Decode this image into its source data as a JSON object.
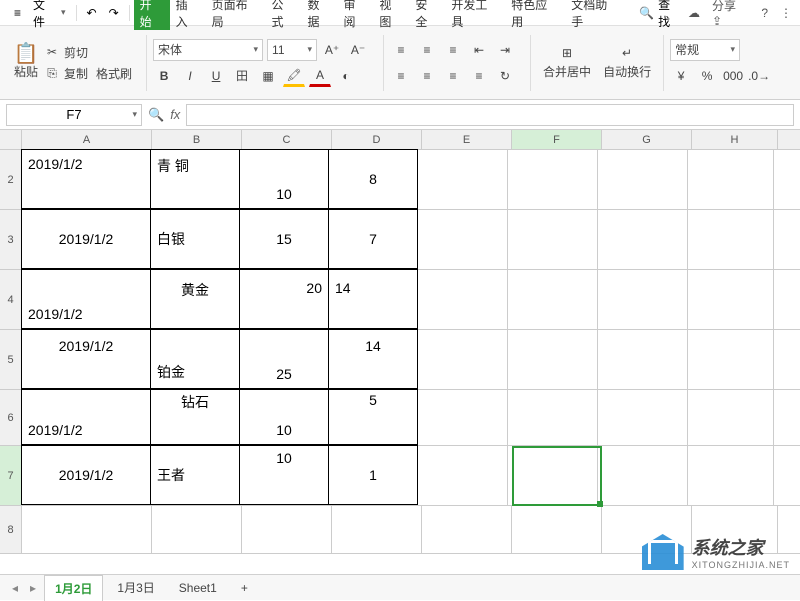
{
  "menu": {
    "file": "文件",
    "tabs": [
      "开始",
      "插入",
      "页面布局",
      "公式",
      "数据",
      "审阅",
      "视图",
      "安全",
      "开发工具",
      "特色应用",
      "文档助手"
    ],
    "search": "查找",
    "share": "分享"
  },
  "ribbon": {
    "paste": "粘贴",
    "cut": "剪切",
    "copy": "复制",
    "format_painter": "格式刷",
    "font_name": "宋体",
    "font_size": "11",
    "merge": "合并居中",
    "wrap": "自动换行",
    "general": "常规"
  },
  "namebox": "F7",
  "fx": "fx",
  "columns": [
    "A",
    "B",
    "C",
    "D",
    "E",
    "F",
    "G",
    "H"
  ],
  "rows": [
    {
      "n": "2",
      "A": "2019/1/2",
      "B": "青      铜",
      "C": "10",
      "D": "8"
    },
    {
      "n": "3",
      "A": "2019/1/2",
      "B": "白银",
      "C": "15",
      "D": "7"
    },
    {
      "n": "4",
      "A": "2019/1/2",
      "B": "黄金",
      "C": "20",
      "D": "14"
    },
    {
      "n": "5",
      "A": "2019/1/2",
      "B": "铂金",
      "C": "25",
      "D": "14"
    },
    {
      "n": "6",
      "A": "2019/1/2",
      "B": "钻石",
      "C": "10",
      "D": "5"
    },
    {
      "n": "7",
      "A": "2019/1/2",
      "B": "王者",
      "C": "10",
      "D": "1"
    },
    {
      "n": "8",
      "A": "",
      "B": "",
      "C": "",
      "D": ""
    }
  ],
  "sheets": {
    "active": "1月2日",
    "others": [
      "1月3日",
      "Sheet1"
    ],
    "add": "+"
  },
  "watermark": {
    "title": "系统之家",
    "sub": "XITONGZHIJIA.NET"
  }
}
